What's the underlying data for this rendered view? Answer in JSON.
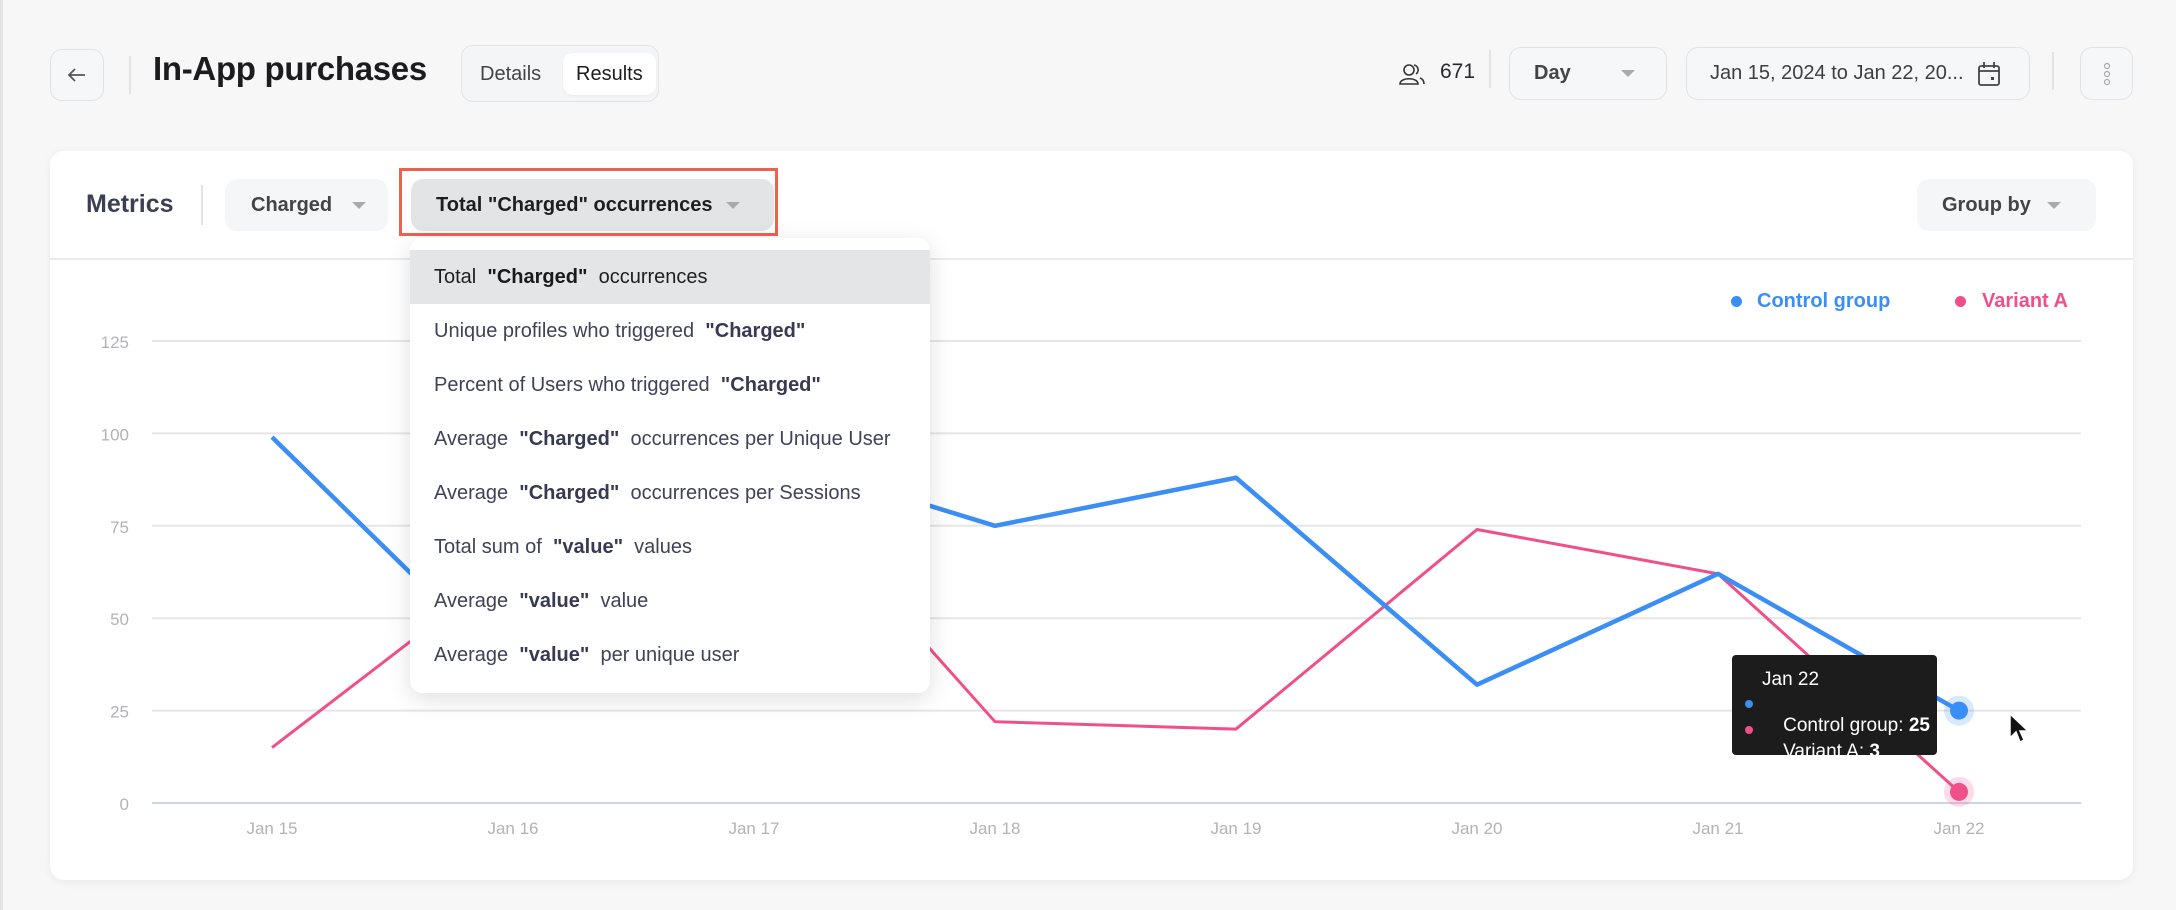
{
  "header": {
    "back_icon": "arrow-left-icon",
    "title": "In-App purchases",
    "tabs": [
      {
        "label": "Details",
        "active": false
      },
      {
        "label": "Results",
        "active": true
      }
    ],
    "users_icon": "users-icon",
    "user_count": "671",
    "granularity": "Day",
    "date_range": "Jan 15, 2024 to Jan 22, 20...",
    "calendar_icon": "calendar-icon",
    "more_icon": "kebab-menu-icon"
  },
  "toolbar": {
    "metrics_label": "Metrics",
    "event_select": "Charged",
    "measure_select": "Total \"Charged\" occurrences",
    "group_by": "Group by"
  },
  "measure_menu": {
    "items": [
      {
        "parts": [
          "Total  ",
          "\"Charged\"",
          "  occurrences"
        ],
        "selected": true
      },
      {
        "parts": [
          "Unique profiles who triggered  ",
          "\"Charged\"",
          ""
        ],
        "selected": false
      },
      {
        "parts": [
          "Percent of Users who triggered  ",
          "\"Charged\"",
          ""
        ],
        "selected": false
      },
      {
        "parts": [
          "Average  ",
          "\"Charged\"",
          "  occurrences per Unique User"
        ],
        "selected": false
      },
      {
        "parts": [
          "Average  ",
          "\"Charged\"",
          "  occurrences per Sessions"
        ],
        "selected": false
      },
      {
        "parts": [
          "Total sum of  ",
          "\"value\"",
          "  values"
        ],
        "selected": false
      },
      {
        "parts": [
          "Average  ",
          "\"value\"",
          "  value"
        ],
        "selected": false
      },
      {
        "parts": [
          "Average  ",
          "\"value\"",
          "  per unique user"
        ],
        "selected": false
      }
    ]
  },
  "tooltip": {
    "date": "Jan 22",
    "rows": [
      {
        "label": "Control group: ",
        "value": "25",
        "color": "#3a8ef6"
      },
      {
        "label": "Variant A: ",
        "value": "3",
        "color": "#f0508a"
      }
    ]
  },
  "chart_data": {
    "type": "line",
    "title": "",
    "xlabel": "",
    "ylabel": "",
    "x": [
      "Jan 15",
      "Jan 16",
      "Jan 17",
      "Jan 18",
      "Jan 19",
      "Jan 20",
      "Jan 21",
      "Jan 22"
    ],
    "yticks": [
      0,
      25,
      50,
      75,
      100,
      125
    ],
    "ylim": [
      0,
      125
    ],
    "grid": true,
    "legend": "top-right",
    "highlighted_x": "Jan 22",
    "series": [
      {
        "name": "Control group",
        "color": "#3a8ef6",
        "values": [
          99,
          35,
          95,
          75,
          88,
          32,
          62,
          25
        ]
      },
      {
        "name": "Variant A",
        "color": "#f0508a",
        "values": [
          15,
          65,
          95,
          22,
          20,
          74,
          62,
          3
        ]
      }
    ]
  }
}
